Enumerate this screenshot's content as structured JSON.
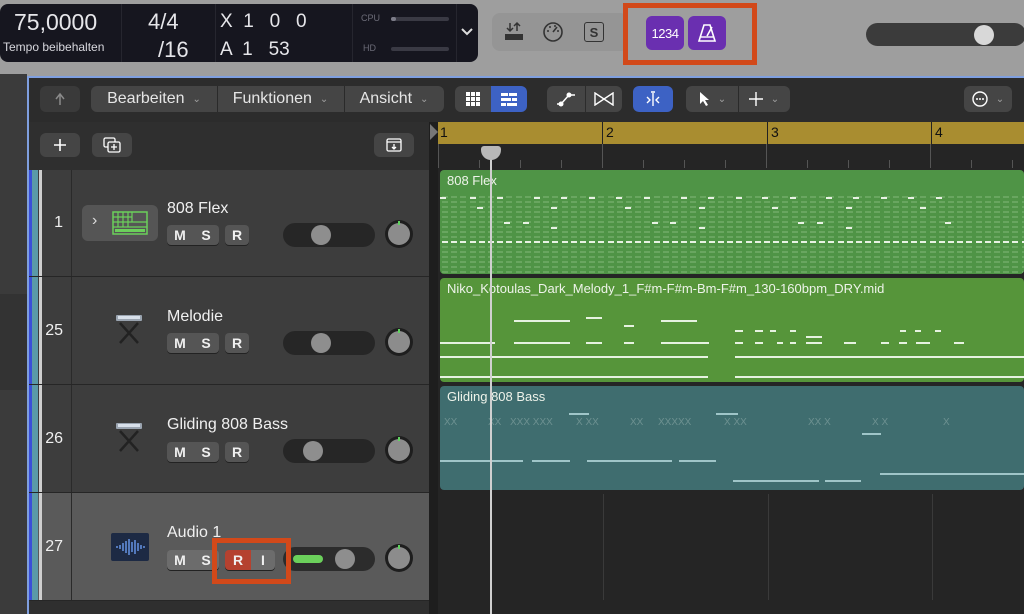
{
  "lcd": {
    "tempo": "75,0000",
    "tempo_label": "Tempo beibehalten",
    "signature_top": "4/4",
    "signature_bottom": "/16",
    "position_x": "X  1   0   0",
    "position_a": "A  1   53",
    "cpu_label": "CPU",
    "hd_label": "HD",
    "expand_icon": "chevron-down-icon"
  },
  "control_bar": {
    "icons": [
      "import-export-icon",
      "tuning-gauge-icon",
      "solo-s-icon"
    ],
    "count_in_label": "1234",
    "metronome_icon": "metronome-icon",
    "master_volume": 0.75
  },
  "toolbar": {
    "back_icon": "up-arrow-icon",
    "menus": [
      "Bearbeiten",
      "Funktionen",
      "Ansicht"
    ],
    "view_buttons": [
      "grid-view-icon",
      "list-view-icon"
    ],
    "automation_icons": [
      "automation-icon",
      "crossfade-icon"
    ],
    "catch_icon": "snap-catch-icon",
    "tool_pointer_icon": "pointer-icon",
    "tool_cross_icon": "crosshair-icon",
    "more_icon": "ellipsis-icon"
  },
  "track_header_toolbar": {
    "add_icon": "plus-icon",
    "duplicate_icon": "duplicate-track-icon",
    "collapse_icon": "download-tray-icon"
  },
  "ruler": {
    "bars": [
      "1",
      "2",
      "3",
      "4"
    ]
  },
  "tracks": [
    {
      "number": "1",
      "name": "808 Flex",
      "icon": "drum-machine-icon",
      "buttons": [
        "M",
        "S",
        "R"
      ],
      "volume": 0.4
    },
    {
      "number": "25",
      "name": "Melodie",
      "icon": "keyboard-stand-icon",
      "buttons": [
        "M",
        "S",
        "R"
      ],
      "volume": 0.4
    },
    {
      "number": "26",
      "name": "Gliding 808 Bass",
      "icon": "keyboard-stand-icon",
      "buttons": [
        "M",
        "S",
        "R"
      ],
      "volume": 0.32
    },
    {
      "number": "27",
      "name": "Audio 1",
      "icon": "audio-waveform-icon",
      "buttons": [
        "M",
        "S",
        "R",
        "I"
      ],
      "volume": 0.68,
      "record_armed": true
    }
  ],
  "regions": [
    {
      "title": "808 Flex",
      "color": "#4f9446"
    },
    {
      "title": "Niko_Kotoulas_Dark_Melody_1_F#m-F#m-Bm-F#m_130-160bpm_DRY.mid",
      "color": "#56953a"
    },
    {
      "title": "Gliding 808 Bass",
      "color": "#3f6d6f"
    }
  ],
  "bass_note_labels": [
    "XX",
    "XX",
    "XXX XXX",
    "X XX",
    "XX",
    "XXXXX",
    "X XX",
    "XX X",
    "X X",
    "X"
  ],
  "highlight_color": "#d2491a"
}
